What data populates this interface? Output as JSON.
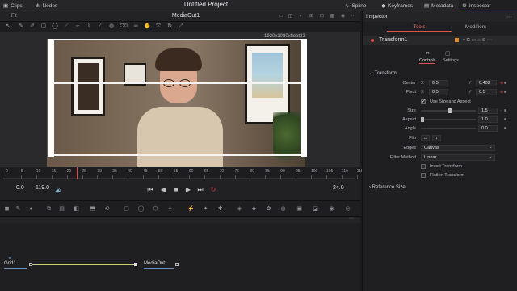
{
  "topbar": {
    "app_icon": "fusion-icon",
    "clips": "Clips",
    "nodes": "Nodes",
    "title": "Untitled Project",
    "spline": "Spline",
    "keyframes": "Keyframes",
    "metadata": "Metadata",
    "inspector": "Inspector"
  },
  "viewer": {
    "fit": "Fit",
    "title": "MediaOut1",
    "resolution": "1920x1080xfloat32"
  },
  "ruler": {
    "ticks": [
      "0",
      "5",
      "10",
      "15",
      "20",
      "25",
      "30",
      "35",
      "40",
      "45",
      "50",
      "55",
      "60",
      "65",
      "70",
      "75",
      "80",
      "85",
      "90",
      "95",
      "100",
      "105",
      "110",
      "115"
    ]
  },
  "transport": {
    "start": "0.0",
    "end": "119.0",
    "current_frame": "24.0"
  },
  "nodes": {
    "grid": "Grid1",
    "mediaout": "MediaOut1"
  },
  "inspector": {
    "header": "Inspector",
    "tab_tools": "Tools",
    "tab_modifiers": "Modifiers",
    "tool_name": "Transform1",
    "subtab_controls": "Controls",
    "subtab_settings": "Settings",
    "section_transform": "Transform",
    "center_label": "Center",
    "center_x": "0.5",
    "center_y": "0.402",
    "pivot_label": "Pivot",
    "pivot_x": "0.5",
    "pivot_y": "0.5",
    "use_size_aspect": "Use Size and Aspect",
    "size_label": "Size",
    "size_value": "1.5",
    "aspect_label": "Aspect",
    "aspect_value": "1.0",
    "angle_label": "Angle",
    "angle_value": "0.0",
    "flip_label": "Flip",
    "edges_label": "Edges",
    "edges_value": "Canvas",
    "filter_label": "Filter Method",
    "filter_value": "Linear",
    "invert_transform": "Invert Transform",
    "flatten_transform": "Flatten Transform",
    "section_reference": "Reference Size",
    "axis_x": "X",
    "axis_y": "Y"
  }
}
